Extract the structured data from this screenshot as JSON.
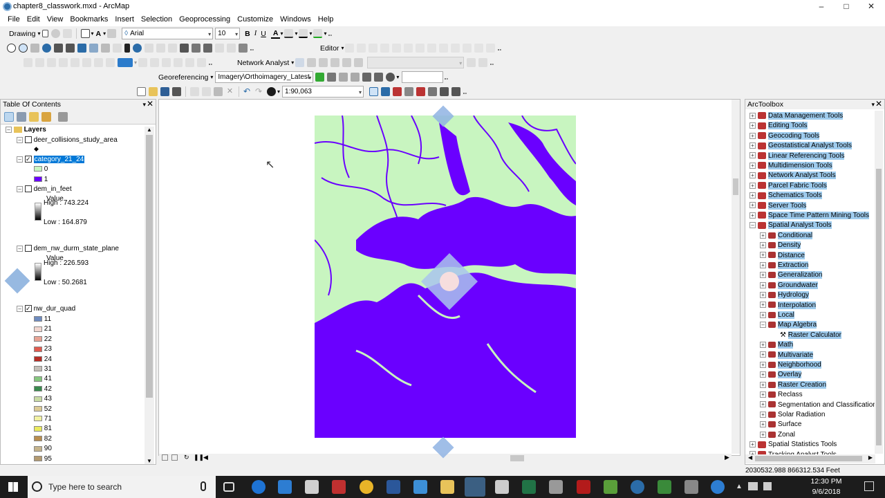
{
  "window": {
    "title": "chapter8_classwork.mxd - ArcMap"
  },
  "menu": [
    "File",
    "Edit",
    "View",
    "Bookmarks",
    "Insert",
    "Selection",
    "Geoprocessing",
    "Customize",
    "Windows",
    "Help"
  ],
  "toolbar": {
    "drawing_label": "Drawing",
    "font_name": "Arial",
    "font_size": "10",
    "bold": "B",
    "italic": "I",
    "underline": "U",
    "text_color": "A",
    "editor_label": "Editor",
    "network_analyst_label": "Network Analyst",
    "georeferencing_label": "Georeferencing",
    "georef_layer": "Imagery\\Orthoimagery_Latest",
    "scale": "1:90,063"
  },
  "toc": {
    "title": "Table Of Contents",
    "root": "Layers",
    "layers": [
      {
        "name": "deer_collisions_study_area",
        "checked": false
      },
      {
        "name": "category_21_24",
        "checked": true,
        "legend": [
          "0",
          "1"
        ]
      },
      {
        "name": "dem_in_feet",
        "checked": false,
        "value_label": "Value",
        "high": "High : 743.224",
        "low": "Low : 164.879"
      },
      {
        "name": "dem_nw_durm_state_plane",
        "checked": false,
        "value_label": "Value",
        "high": "High : 226.593",
        "low": "Low : 50.2681"
      },
      {
        "name": "nw_dur_quad",
        "checked": true,
        "classes": [
          {
            "label": "11",
            "color": "#6e8bbf"
          },
          {
            "label": "21",
            "color": "#f2d7d0"
          },
          {
            "label": "22",
            "color": "#e8a394"
          },
          {
            "label": "23",
            "color": "#e05a4f"
          },
          {
            "label": "24",
            "color": "#b62d25"
          },
          {
            "label": "31",
            "color": "#c4bfb8"
          },
          {
            "label": "41",
            "color": "#85c77e"
          },
          {
            "label": "42",
            "color": "#3a8a4e"
          },
          {
            "label": "43",
            "color": "#c9dba5"
          },
          {
            "label": "52",
            "color": "#dccb95"
          },
          {
            "label": "71",
            "color": "#f2f2a3"
          },
          {
            "label": "81",
            "color": "#eaea5e"
          },
          {
            "label": "82",
            "color": "#b98e4f"
          },
          {
            "label": "90",
            "color": "#c5b48c"
          },
          {
            "label": "95",
            "color": "#b39a70"
          }
        ]
      }
    ]
  },
  "map": {
    "background_color": "#c8f5c0",
    "feature_color": "#6a00ff"
  },
  "arctoolbox": {
    "title": "ArcToolbox",
    "top_tools": [
      "Data Management Tools",
      "Editing Tools",
      "Geocoding Tools",
      "Geostatistical Analyst Tools",
      "Linear Referencing Tools",
      "Multidimension Tools",
      "Network Analyst Tools",
      "Parcel Fabric Tools",
      "Schematics Tools",
      "Server Tools",
      "Space Time Pattern Mining Tools",
      "Spatial Analyst Tools"
    ],
    "spatial_analyst_children": [
      "Conditional",
      "Density",
      "Distance",
      "Extraction",
      "Generalization",
      "Groundwater",
      "Hydrology",
      "Interpolation",
      "Local",
      "Map Algebra"
    ],
    "map_algebra_tool": "Raster Calculator",
    "spatial_analyst_children_after": [
      "Math",
      "Multivariate",
      "Neighborhood",
      "Overlay",
      "Raster Creation",
      "Reclass",
      "Segmentation and Classification",
      "Solar Radiation",
      "Surface",
      "Zonal"
    ],
    "bottom_tools": [
      "Spatial Statistics Tools",
      "Tracking Analyst Tools"
    ]
  },
  "status": {
    "coordinates": "2030532.988  866312.534 Feet"
  },
  "taskbar": {
    "search_placeholder": "Type here to search",
    "time": "12:30 PM",
    "date": "9/6/2018"
  }
}
